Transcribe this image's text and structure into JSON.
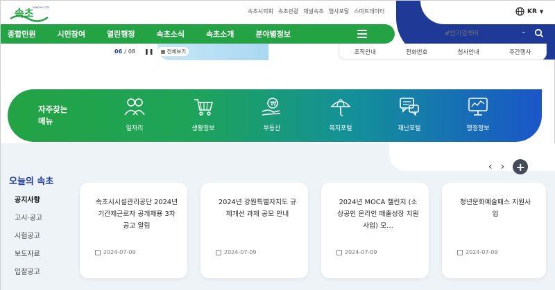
{
  "header": {
    "logo_text": "속초",
    "logo_sub": "SOKCHO CITY",
    "top_links": [
      "속초시의회",
      "속초관광",
      "채널속초",
      "행사포털",
      "스마트데이터"
    ],
    "lang": "KR"
  },
  "nav": {
    "items": [
      "종합민원",
      "시민참여",
      "열린행정",
      "속초소식",
      "속초소개",
      "분야별정보"
    ]
  },
  "search": {
    "placeholder": "#인기검색어"
  },
  "banner": {
    "current": "06",
    "separator": "/",
    "total": "08",
    "view_all": "전체보기"
  },
  "quick_tabs": [
    "조직안내",
    "전화번호",
    "청사안내",
    "주간행사"
  ],
  "frequent_menu": {
    "title_line1": "자주찾는",
    "title_line2": "메뉴",
    "items": [
      {
        "label": "일자리",
        "icon": "people-icon"
      },
      {
        "label": "생활정보",
        "icon": "cart-icon"
      },
      {
        "label": "부동산",
        "icon": "money-hand-icon"
      },
      {
        "label": "복지포털",
        "icon": "umbrella-icon"
      },
      {
        "label": "재난포털",
        "icon": "chat-alert-icon"
      },
      {
        "label": "행정정보",
        "icon": "dashboard-icon"
      }
    ]
  },
  "today": {
    "title": "오늘의 속초",
    "categories": [
      "공지사항",
      "고시·공고",
      "시험공고",
      "보도자료",
      "입찰공고"
    ],
    "active_category": "공지사항",
    "cards": [
      {
        "text": "속초시시설관리공단 2024년 기간제근로자 공개채용 3차 공고 알림",
        "date": "2024-07-09"
      },
      {
        "text": "2024년 강원특별자치도 규제개선 과제 공모 안내",
        "date": "2024-07-09"
      },
      {
        "text": "2024년 MOCA 챌린지 (소상공인 온라인 매출성장 지원사업) 모…",
        "date": "2024-07-09"
      },
      {
        "text": "청년문화예술패스 지원사업",
        "date": "2024-07-09"
      }
    ]
  },
  "colors": {
    "green": "#23a344",
    "navy": "#1e3a96",
    "blue": "#1a56c9"
  }
}
